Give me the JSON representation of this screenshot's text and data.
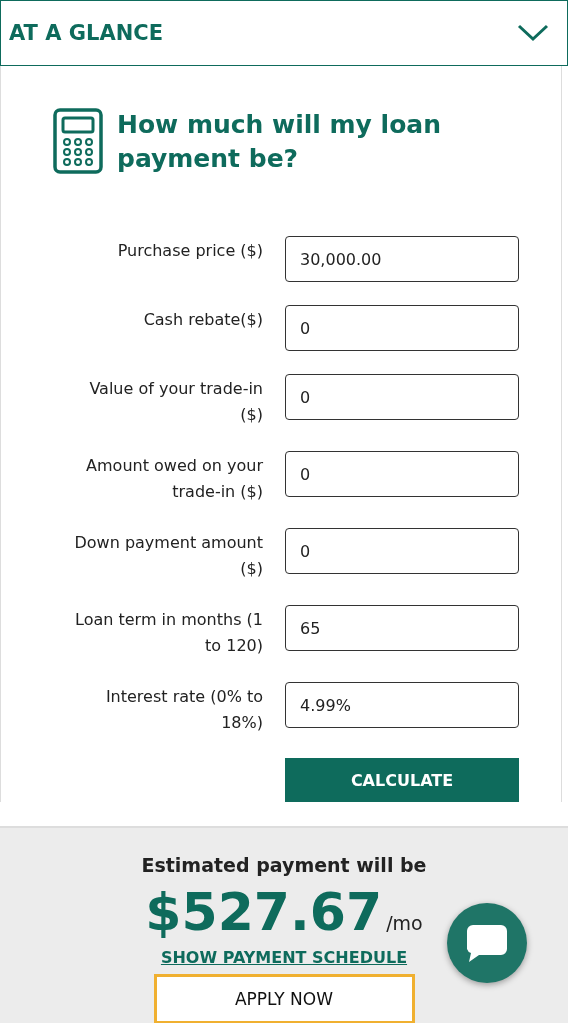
{
  "header": {
    "title": "AT A GLANCE"
  },
  "calculator": {
    "title": "How much will my loan payment be?",
    "fields": [
      {
        "label": "Purchase price ($)",
        "value": "30,000.00"
      },
      {
        "label": "Cash rebate($)",
        "value": "0"
      },
      {
        "label": "Value of your trade-in ($)",
        "value": "0"
      },
      {
        "label": "Amount owed on your trade-in ($)",
        "value": "0"
      },
      {
        "label": "Down payment amount ($)",
        "value": "0"
      },
      {
        "label": "Loan term in months (1 to 120)",
        "value": "65"
      },
      {
        "label": "Interest rate (0% to 18%)",
        "value": "4.99%"
      }
    ],
    "calculate_button": "CALCULATE"
  },
  "result": {
    "caption": "Estimated payment will be",
    "amount": "$527.67",
    "unit": "/mo",
    "schedule_link": "SHOW PAYMENT SCHEDULE",
    "apply_button": "APPLY NOW"
  }
}
